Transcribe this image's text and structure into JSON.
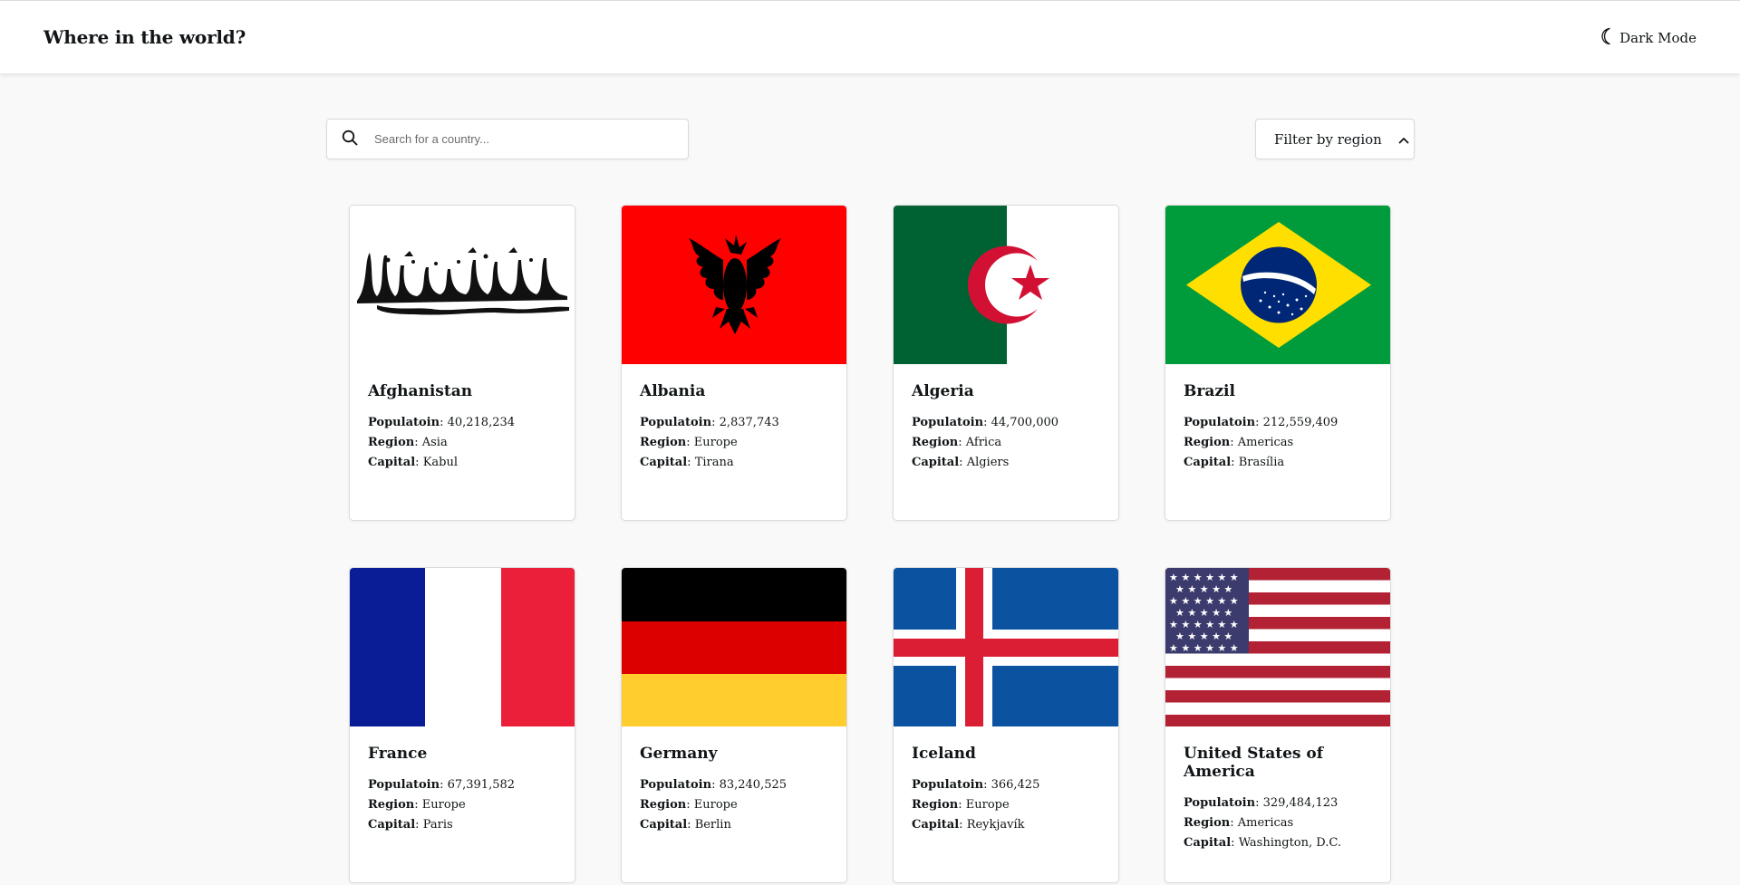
{
  "header": {
    "title": "Where in the world?",
    "mode_label": "Dark Mode"
  },
  "search": {
    "placeholder": "Search for a country..."
  },
  "filter": {
    "label": "Filter by region"
  },
  "labels": {
    "population": "Populatoin",
    "region": "Region",
    "capital": "Capital"
  },
  "countries": [
    {
      "name": "Afghanistan",
      "population": "40,218,234",
      "region": "Asia",
      "capital": "Kabul",
      "flag": "afghanistan-flag"
    },
    {
      "name": "Albania",
      "population": "2,837,743",
      "region": "Europe",
      "capital": "Tirana",
      "flag": "albania-flag"
    },
    {
      "name": "Algeria",
      "population": "44,700,000",
      "region": "Africa",
      "capital": "Algiers",
      "flag": "algeria-flag"
    },
    {
      "name": "Brazil",
      "population": "212,559,409",
      "region": "Americas",
      "capital": "Brasília",
      "flag": "brazil-flag"
    },
    {
      "name": "France",
      "population": "67,391,582",
      "region": "Europe",
      "capital": "Paris",
      "flag": "france-flag"
    },
    {
      "name": "Germany",
      "population": "83,240,525",
      "region": "Europe",
      "capital": "Berlin",
      "flag": "germany-flag"
    },
    {
      "name": "Iceland",
      "population": "366,425",
      "region": "Europe",
      "capital": "Reykjavík",
      "flag": "iceland-flag"
    },
    {
      "name": "United States of America",
      "population": "329,484,123",
      "region": "Americas",
      "capital": "Washington, D.C.",
      "flag": "usa-flag"
    }
  ],
  "colors": {
    "background": "#f9f9f9",
    "surface": "#ffffff",
    "text": "#111517"
  }
}
